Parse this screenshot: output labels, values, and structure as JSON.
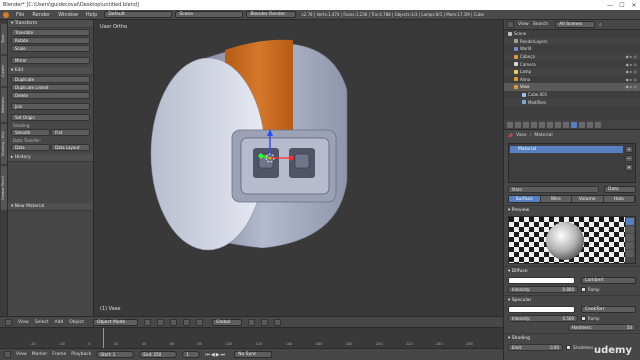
{
  "window": {
    "title": "Blender* [C:\\Users\\guidecoval\\Desktop\\untitled.blend]",
    "minimize": "—",
    "maximize": "☐",
    "close": "✕"
  },
  "topmenu": {
    "items": [
      "File",
      "Render",
      "Window",
      "Help"
    ],
    "layout": "Default",
    "scene": "Scene",
    "engine": "Blender Render",
    "stats": "v2.78 | Verts:1,474 | Faces:1,236 | Tris:4,788 | Objects:1/3 | Lamps:0/1 | Mem:17.1M | Cube"
  },
  "left_tabs": [
    "Tools",
    "Create",
    "Relations",
    "Shading / UVs",
    "Grease Pencil"
  ],
  "toolshelf": {
    "transform_header": "Transform",
    "transform": [
      "Translate",
      "Rotate",
      "Scale",
      "Mirror"
    ],
    "edit_header": "Edit",
    "edit": [
      "Duplicate",
      "Duplicate Linked",
      "Delete",
      "Join"
    ],
    "set_origin": "Set Origin",
    "shading_label": "Shading:",
    "smooth": "Smooth",
    "flat": "Flat",
    "data_transfer_label": "Data Transfer:",
    "data": "Data",
    "data_layout": "Data Layout",
    "history_header": "History",
    "operator_header": "New Material"
  },
  "viewport": {
    "view_label": "User Ortho",
    "object_label": "(1) Vase"
  },
  "viewport_header": {
    "menus": [
      "View",
      "Select",
      "Add",
      "Object"
    ],
    "mode": "Object Mode",
    "pivot": "Global"
  },
  "timeline_header": {
    "menus": [
      "View",
      "Marker",
      "Frame",
      "Playback"
    ],
    "start_label": "Start:",
    "start": "1",
    "end_label": "End:",
    "end": "250",
    "current": "1",
    "sync": "No Sync",
    "ticks": [
      "-40",
      "-20",
      "0",
      "20",
      "40",
      "60",
      "80",
      "100",
      "120",
      "140",
      "160",
      "180",
      "200",
      "220",
      "240",
      "260"
    ]
  },
  "outliner": {
    "menus": [
      "View",
      "Search"
    ],
    "filter": "All Scenes",
    "rows": [
      "Scene",
      "RenderLayers",
      "World",
      "Cabeça",
      "Camera",
      "Lamp",
      "Alma",
      "Vase",
      "Cube.001",
      "Modifiers"
    ]
  },
  "properties": {
    "ctx_object": "Vase",
    "ctx_material": "Material",
    "slot_name": "Material",
    "mat_name": "Mate",
    "data_label": "Data",
    "tabs": [
      "Surface",
      "Wire",
      "Volume",
      "Halo"
    ],
    "preview_header": "Preview",
    "diffuse_header": "Diffuse",
    "diffuse_shader": "Lambert",
    "intensity_label": "Intensity:",
    "diffuse_intensity": "0.800",
    "ramp": "Ramp",
    "specular_header": "Specular",
    "spec_shader": "CookTorr",
    "spec_intensity": "0.500",
    "hardness_label": "Hardness:",
    "hardness": "50",
    "shading_header": "Shading",
    "emit_label": "Emit:",
    "emit": "0.00",
    "shadeless": "Shadeless"
  },
  "colors": {
    "accent": "#5680c2",
    "stripe": "#c96a1e",
    "object_grey": "#a9afc4"
  },
  "watermark": "udemy"
}
